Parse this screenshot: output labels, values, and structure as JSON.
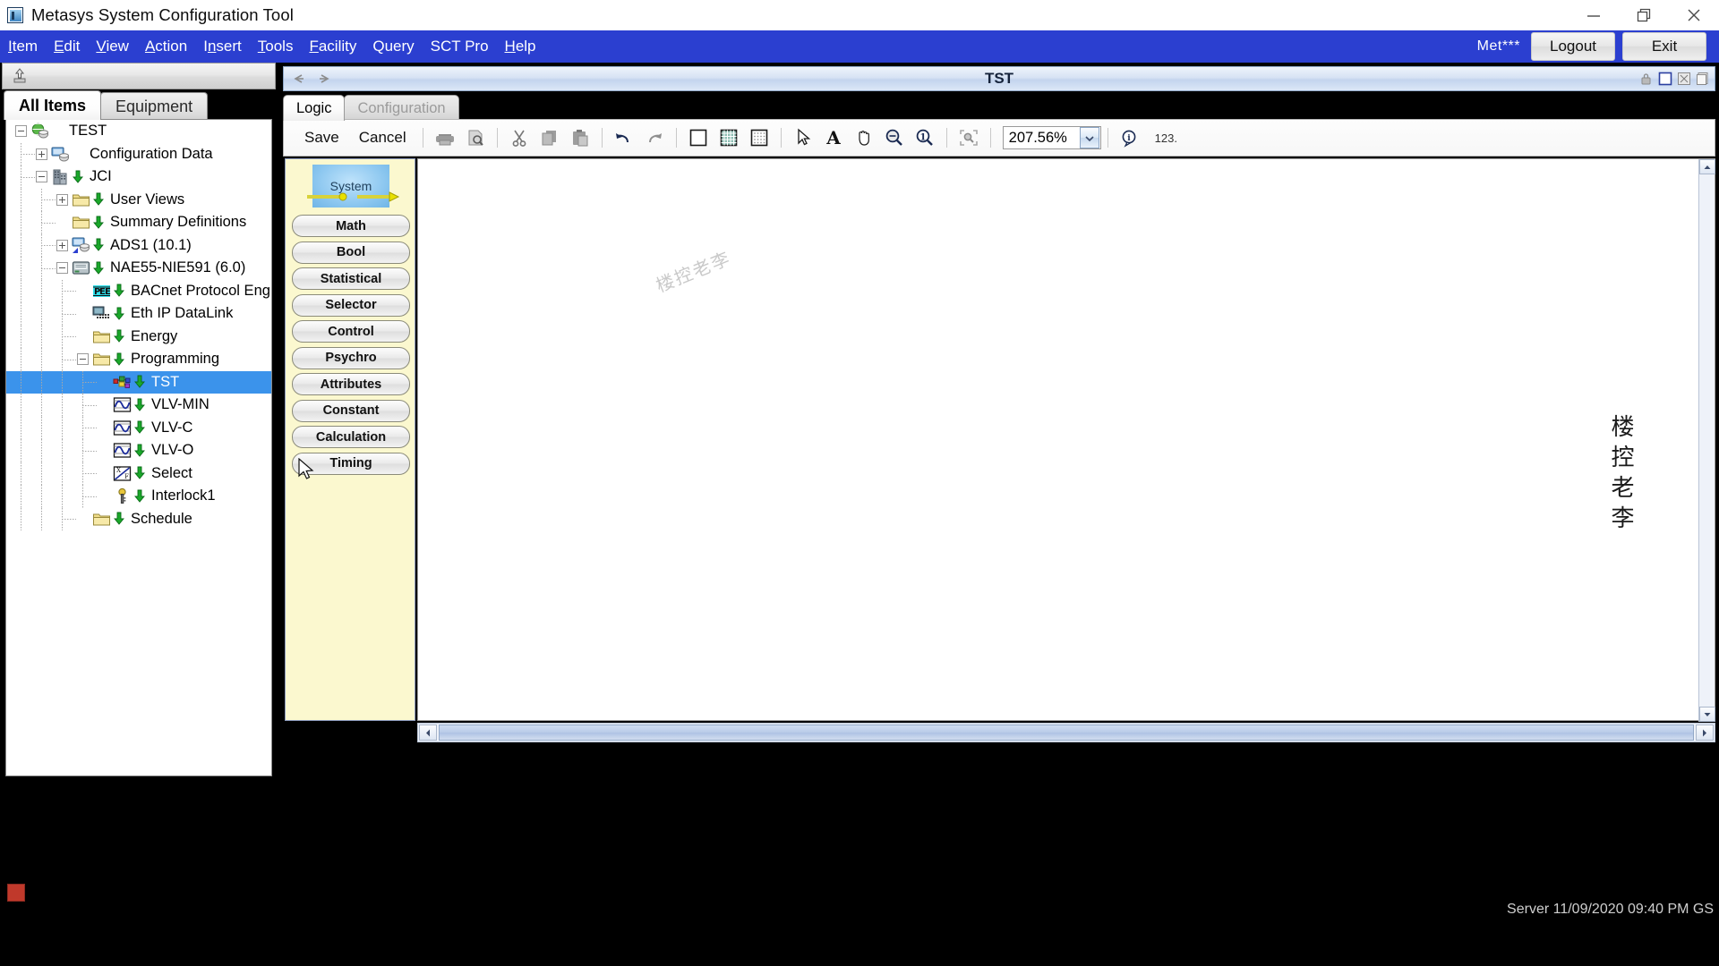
{
  "window": {
    "title": "Metasys System Configuration Tool",
    "app_icon": "metasys-app-icon",
    "minimize": "minimize-icon",
    "restore": "restore-icon",
    "close": "close-icon"
  },
  "menubar": {
    "items": [
      {
        "label": "Item",
        "accel": "I"
      },
      {
        "label": "Edit",
        "accel": "E"
      },
      {
        "label": "View",
        "accel": "V"
      },
      {
        "label": "Action",
        "accel": "A"
      },
      {
        "label": "Insert",
        "accel": "n"
      },
      {
        "label": "Tools",
        "accel": "T"
      },
      {
        "label": "Facility",
        "accel": "F"
      },
      {
        "label": "Query",
        "accel": "Q"
      },
      {
        "label": "SCT Pro",
        "accel": ""
      },
      {
        "label": "Help",
        "accel": "H"
      }
    ],
    "user": "Met***",
    "logout": "Logout",
    "exit": "Exit"
  },
  "sidebar": {
    "tabs": [
      {
        "label": "All Items",
        "active": true
      },
      {
        "label": "Equipment",
        "active": false
      }
    ],
    "tree": [
      {
        "label": "TEST",
        "depth": 0,
        "expander": "minus",
        "icon": "globe-site-icon",
        "arrow": false,
        "selected": false
      },
      {
        "label": "Configuration Data",
        "depth": 1,
        "expander": "plus",
        "icon": "server-icon",
        "arrow": false,
        "selected": false
      },
      {
        "label": "JCI",
        "depth": 1,
        "expander": "minus",
        "icon": "building-icon",
        "arrow": true,
        "selected": false
      },
      {
        "label": "User Views",
        "depth": 2,
        "expander": "plus",
        "icon": "folder-icon",
        "arrow": true,
        "selected": false
      },
      {
        "label": "Summary Definitions",
        "depth": 2,
        "expander": "none",
        "icon": "folder-icon",
        "arrow": true,
        "selected": false
      },
      {
        "label": "ADS1 (10.1)",
        "depth": 2,
        "expander": "plus",
        "icon": "ads-server-icon",
        "arrow": true,
        "selected": false
      },
      {
        "label": "NAE55-NIE591 (6.0)",
        "depth": 2,
        "expander": "minus",
        "icon": "nae-device-icon",
        "arrow": true,
        "selected": false
      },
      {
        "label": "BACnet Protocol Eng",
        "depth": 3,
        "expander": "none",
        "icon": "bacnet-icon",
        "arrow": true,
        "selected": false
      },
      {
        "label": "Eth IP DataLink",
        "depth": 3,
        "expander": "none",
        "icon": "ethernet-icon",
        "arrow": true,
        "selected": false
      },
      {
        "label": "Energy",
        "depth": 3,
        "expander": "none",
        "icon": "folder-icon",
        "arrow": true,
        "selected": false
      },
      {
        "label": "Programming",
        "depth": 3,
        "expander": "minus",
        "icon": "folder-icon",
        "arrow": true,
        "selected": false
      },
      {
        "label": "TST",
        "depth": 4,
        "expander": "none",
        "icon": "logic-program-icon",
        "arrow": true,
        "selected": true
      },
      {
        "label": "VLV-MIN",
        "depth": 4,
        "expander": "none",
        "icon": "graphic-icon",
        "arrow": true,
        "selected": false
      },
      {
        "label": "VLV-C",
        "depth": 4,
        "expander": "none",
        "icon": "graphic-icon",
        "arrow": true,
        "selected": false
      },
      {
        "label": "VLV-O",
        "depth": 4,
        "expander": "none",
        "icon": "graphic-icon",
        "arrow": true,
        "selected": false
      },
      {
        "label": "Select",
        "depth": 4,
        "expander": "none",
        "icon": "select-icon",
        "arrow": true,
        "selected": false
      },
      {
        "label": "Interlock1",
        "depth": 4,
        "expander": "none",
        "icon": "interlock-key-icon",
        "arrow": true,
        "selected": false
      },
      {
        "label": "Schedule",
        "depth": 3,
        "expander": "none",
        "icon": "folder-icon",
        "arrow": true,
        "selected": false
      }
    ],
    "nav_toolbar_icon": "upload-item-icon"
  },
  "document": {
    "title": "TST",
    "back_icon": "back-arrow-icon",
    "forward_icon": "forward-arrow-icon",
    "right_icons": [
      "lock-icon",
      "maximize-panel-icon",
      "close-panel-icon",
      "copy-panel-icon"
    ],
    "tabs": [
      {
        "label": "Logic",
        "active": true
      },
      {
        "label": "Configuration",
        "active": false
      }
    ]
  },
  "toolbar": {
    "save_label": "Save",
    "cancel_label": "Cancel",
    "icons": [
      "print-icon",
      "print-preview-icon",
      "cut-icon",
      "copy-icon",
      "paste-icon",
      "undo-icon",
      "redo-icon",
      "white-background-icon",
      "grid-background-icon",
      "dot-grid-background-icon",
      "select-pointer-icon",
      "text-tool-icon",
      "pan-hand-icon",
      "zoom-out-icon",
      "zoom-in-icon",
      "zoom-region-icon"
    ],
    "zoom_value": "207.56%",
    "zoom_dropdown_icon": "chevron-down-icon",
    "info_icon": "info-balloon-icon",
    "number_label": "123."
  },
  "palette": {
    "system_block": "System",
    "buttons": [
      "Math",
      "Bool",
      "Statistical",
      "Selector",
      "Control",
      "Psychro",
      "Attributes",
      "Constant",
      "Calculation",
      "Timing"
    ]
  },
  "canvas": {
    "watermark": "楼控老李",
    "watermark_faint": "楼控老李",
    "hscroll_left_icon": "scroll-left-icon",
    "hscroll_right_icon": "scroll-right-icon",
    "vscroll_up_icon": "scroll-up-icon",
    "vscroll_down_icon": "scroll-down-icon"
  },
  "statusbar": {
    "text": "Server 11/09/2020  09:40 PM  GS",
    "tray_icon": "app-tray-icon"
  },
  "colors": {
    "menubar_blue": "#2b3fd0",
    "selection_blue": "#3b93eb",
    "palette_yellow": "#fbf8cf",
    "system_block_blue": "#8ec8f0"
  }
}
